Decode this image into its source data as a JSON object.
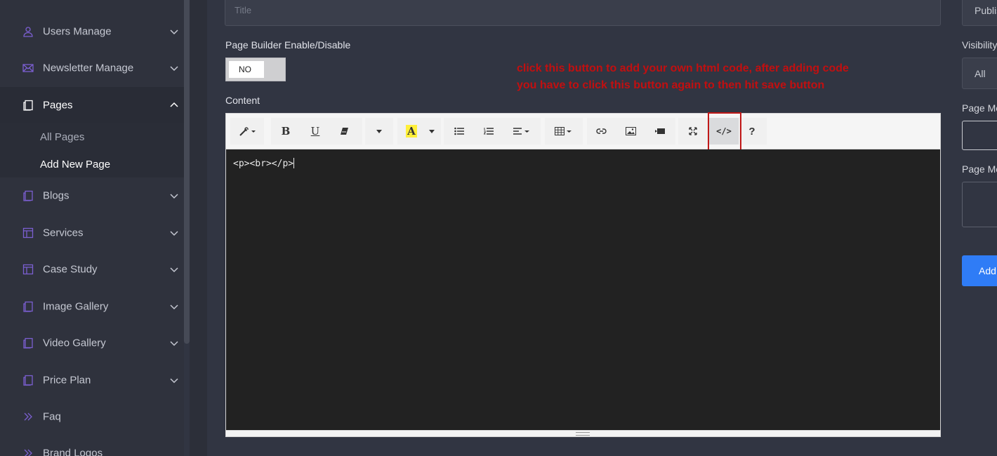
{
  "sidebar": {
    "items": [
      {
        "label": "Users Manage",
        "icon": "user-icon",
        "expandable": true
      },
      {
        "label": "Newsletter Manage",
        "icon": "envelope-icon",
        "expandable": true
      },
      {
        "label": "Pages",
        "icon": "pages-icon",
        "expandable": true,
        "expanded": true
      },
      {
        "label": "Blogs",
        "icon": "blog-icon",
        "expandable": true
      },
      {
        "label": "Services",
        "icon": "services-icon",
        "expandable": true
      },
      {
        "label": "Case Study",
        "icon": "case-study-icon",
        "expandable": true
      },
      {
        "label": "Image Gallery",
        "icon": "image-gallery-icon",
        "expandable": true
      },
      {
        "label": "Video Gallery",
        "icon": "video-gallery-icon",
        "expandable": true
      },
      {
        "label": "Price Plan",
        "icon": "price-plan-icon",
        "expandable": true
      },
      {
        "label": "Faq",
        "icon": "faq-icon",
        "expandable": false
      },
      {
        "label": "Brand Logos",
        "icon": "brand-logos-icon",
        "expandable": false
      }
    ],
    "pages_sub": [
      {
        "label": "All Pages",
        "active": false
      },
      {
        "label": "Add New Page",
        "active": true
      }
    ]
  },
  "form": {
    "title_placeholder": "Title",
    "page_builder_label": "Page Builder Enable/Disable",
    "page_builder_value": "NO",
    "content_label": "Content"
  },
  "annotation": {
    "line1": "click this button to add your own html code, after adding code",
    "line2": "you have to click this button again to then hit save button"
  },
  "editor": {
    "code": "<p><br></p>",
    "toolbar": [
      {
        "name": "magic-style-icon"
      },
      {
        "name": "bold-icon",
        "text": "B"
      },
      {
        "name": "underline-icon",
        "text": "U"
      },
      {
        "name": "eraser-icon"
      },
      {
        "name": "font-dropdown-caret"
      },
      {
        "name": "highlight-color-icon",
        "text": "A"
      },
      {
        "name": "unordered-list-icon"
      },
      {
        "name": "ordered-list-icon"
      },
      {
        "name": "align-icon"
      },
      {
        "name": "table-icon"
      },
      {
        "name": "link-icon"
      },
      {
        "name": "picture-icon"
      },
      {
        "name": "video-icon"
      },
      {
        "name": "fullscreen-icon"
      },
      {
        "name": "code-view-icon",
        "text": "</>"
      },
      {
        "name": "help-icon",
        "text": "?"
      }
    ]
  },
  "right_panel": {
    "status_value": "Publis",
    "visibility_label": "Visibility",
    "visibility_value": "All",
    "meta_label_1": "Page Me",
    "meta_label_2": "Page Me",
    "add_button": "Add"
  },
  "colors": {
    "background": "#313542",
    "sidebar": "#2f323d",
    "annotation": "#c20f10",
    "add_button": "#2f7cf6",
    "sidebar_icon": "#7b5fd1"
  }
}
